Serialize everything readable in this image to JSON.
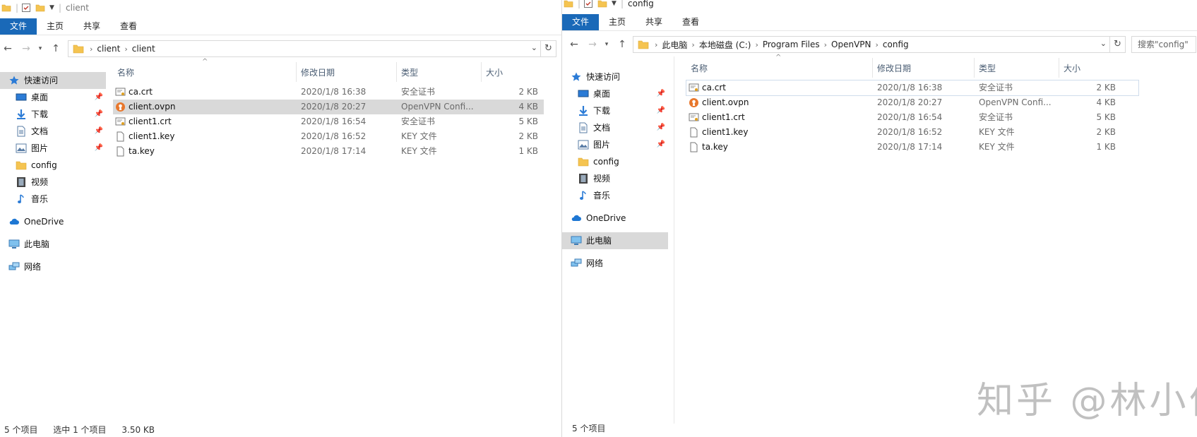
{
  "colors": {
    "file_tab": "#1a69b8",
    "selection": "#d9d9d9",
    "header_text": "#4a5d73",
    "folder": "#f5c451",
    "watermark": "#5a5a5a"
  },
  "ribbon_tabs": [
    "文件",
    "主页",
    "共享",
    "查看"
  ],
  "left": {
    "title": "client",
    "address": [
      "client",
      "client"
    ],
    "nav": [
      {
        "label": "快速访问",
        "icon": "star-icon",
        "pinned": false
      },
      {
        "label": "桌面",
        "icon": "desktop-icon",
        "pinned": true
      },
      {
        "label": "下载",
        "icon": "download-icon",
        "pinned": true
      },
      {
        "label": "文档",
        "icon": "document-icon",
        "pinned": true
      },
      {
        "label": "图片",
        "icon": "picture-icon",
        "pinned": true
      },
      {
        "label": "config",
        "icon": "folder-icon",
        "pinned": false
      },
      {
        "label": "视频",
        "icon": "video-icon",
        "pinned": false
      },
      {
        "label": "音乐",
        "icon": "music-icon",
        "pinned": false
      },
      {
        "label": "OneDrive",
        "icon": "cloud-icon",
        "pinned": false
      },
      {
        "label": "此电脑",
        "icon": "computer-icon",
        "pinned": false
      },
      {
        "label": "网络",
        "icon": "network-icon",
        "pinned": false
      }
    ],
    "status_count": "5 个项目",
    "status_selected": "选中 1 个项目",
    "status_size": "3.50 KB"
  },
  "right": {
    "title": "config",
    "address": [
      "此电脑",
      "本地磁盘 (C:)",
      "Program Files",
      "OpenVPN",
      "config"
    ],
    "search_placeholder": "搜索\"config\"",
    "nav": [
      {
        "label": "快速访问",
        "icon": "star-icon",
        "pinned": false
      },
      {
        "label": "桌面",
        "icon": "desktop-icon",
        "pinned": true
      },
      {
        "label": "下载",
        "icon": "download-icon",
        "pinned": true
      },
      {
        "label": "文档",
        "icon": "document-icon",
        "pinned": true
      },
      {
        "label": "图片",
        "icon": "picture-icon",
        "pinned": true
      },
      {
        "label": "config",
        "icon": "folder-icon",
        "pinned": false
      },
      {
        "label": "视频",
        "icon": "video-icon",
        "pinned": false
      },
      {
        "label": "音乐",
        "icon": "music-icon",
        "pinned": false
      },
      {
        "label": "OneDrive",
        "icon": "cloud-icon",
        "pinned": false
      },
      {
        "label": "此电脑",
        "icon": "computer-icon",
        "pinned": false
      },
      {
        "label": "网络",
        "icon": "network-icon",
        "pinned": false
      }
    ],
    "status_count": "5 个项目"
  },
  "columns": {
    "name": "名称",
    "date": "修改日期",
    "type": "类型",
    "size": "大小"
  },
  "files": [
    {
      "name": "ca.crt",
      "date": "2020/1/8 16:38",
      "type_left": "安全证书",
      "type_right": "安全证书",
      "size": "2 KB",
      "icon": "certificate-icon"
    },
    {
      "name": "client.ovpn",
      "date": "2020/1/8 20:27",
      "type_left": "OpenVPN Confi...",
      "type_right": "OpenVPN Confi...",
      "size": "4 KB",
      "icon": "openvpn-icon"
    },
    {
      "name": "client1.crt",
      "date": "2020/1/8 16:54",
      "type_left": "安全证书",
      "type_right": "安全证书",
      "size": "5 KB",
      "icon": "certificate-icon"
    },
    {
      "name": "client1.key",
      "date": "2020/1/8 16:52",
      "type_left": "KEY 文件",
      "type_right": "KEY 文件",
      "size": "2 KB",
      "icon": "file-icon"
    },
    {
      "name": "ta.key",
      "date": "2020/1/8 17:14",
      "type_left": "KEY 文件",
      "type_right": "KEY 文件",
      "size": "1 KB",
      "icon": "file-icon"
    }
  ],
  "watermark": "知乎 @林小伟"
}
